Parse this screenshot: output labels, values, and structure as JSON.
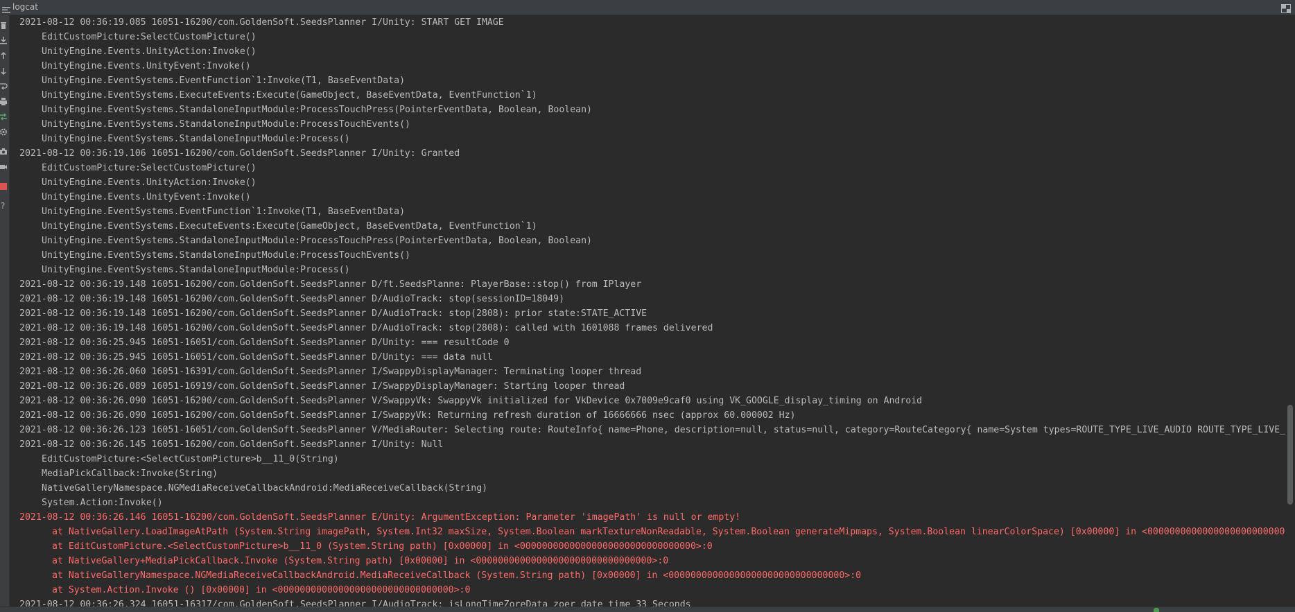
{
  "window": {
    "title": "logcat"
  },
  "icons": {
    "menu": "list-menu-icon",
    "layout": "layout-grid-icon",
    "toolbar": [
      "trash-icon",
      "scroll-to-end-icon",
      "arrow-up-icon",
      "arrow-down-icon",
      "soft-wrap-icon",
      "print-icon",
      "restart-icon",
      "settings-icon",
      "camera-icon",
      "video-icon",
      "stop-icon",
      "help-icon"
    ]
  },
  "colors": {
    "background": "#2b2b2b",
    "text": "#bbbbbb",
    "error": "#ff6b68",
    "stop_red": "#e05252",
    "restart_green": "#59a869"
  },
  "log": {
    "lines": [
      "2021-08-12 00:36:19.085 16051-16200/com.GoldenSoft.SeedsPlanner I/Unity: START GET IMAGE",
      "EditCustomPicture:SelectCustomPicture()",
      "UnityEngine.Events.UnityAction:Invoke()",
      "UnityEngine.Events.UnityEvent:Invoke()",
      "UnityEngine.EventSystems.EventFunction`1:Invoke(T1, BaseEventData)",
      "UnityEngine.EventSystems.ExecuteEvents:Execute(GameObject, BaseEventData, EventFunction`1)",
      "UnityEngine.EventSystems.StandaloneInputModule:ProcessTouchPress(PointerEventData, Boolean, Boolean)",
      "UnityEngine.EventSystems.StandaloneInputModule:ProcessTouchEvents()",
      "UnityEngine.EventSystems.StandaloneInputModule:Process()",
      "2021-08-12 00:36:19.106 16051-16200/com.GoldenSoft.SeedsPlanner I/Unity: Granted",
      "EditCustomPicture:SelectCustomPicture()",
      "UnityEngine.Events.UnityAction:Invoke()",
      "UnityEngine.Events.UnityEvent:Invoke()",
      "UnityEngine.EventSystems.EventFunction`1:Invoke(T1, BaseEventData)",
      "UnityEngine.EventSystems.ExecuteEvents:Execute(GameObject, BaseEventData, EventFunction`1)",
      "UnityEngine.EventSystems.StandaloneInputModule:ProcessTouchPress(PointerEventData, Boolean, Boolean)",
      "UnityEngine.EventSystems.StandaloneInputModule:ProcessTouchEvents()",
      "UnityEngine.EventSystems.StandaloneInputModule:Process()",
      "2021-08-12 00:36:19.148 16051-16200/com.GoldenSoft.SeedsPlanner D/ft.SeedsPlanne: PlayerBase::stop() from IPlayer",
      "2021-08-12 00:36:19.148 16051-16200/com.GoldenSoft.SeedsPlanner D/AudioTrack: stop(sessionID=18049)",
      "2021-08-12 00:36:19.148 16051-16200/com.GoldenSoft.SeedsPlanner D/AudioTrack: stop(2808): prior state:STATE_ACTIVE",
      "2021-08-12 00:36:19.148 16051-16200/com.GoldenSoft.SeedsPlanner D/AudioTrack: stop(2808): called with 1601088 frames delivered",
      "2021-08-12 00:36:25.945 16051-16051/com.GoldenSoft.SeedsPlanner D/Unity: === resultCode 0",
      "2021-08-12 00:36:25.945 16051-16051/com.GoldenSoft.SeedsPlanner D/Unity: === data null",
      "2021-08-12 00:36:26.060 16051-16391/com.GoldenSoft.SeedsPlanner I/SwappyDisplayManager: Terminating looper thread",
      "2021-08-12 00:36:26.089 16051-16919/com.GoldenSoft.SeedsPlanner I/SwappyDisplayManager: Starting looper thread",
      "2021-08-12 00:36:26.090 16051-16200/com.GoldenSoft.SeedsPlanner V/SwappyVk: SwappyVk initialized for VkDevice 0x7009e9caf0 using VK_GOOGLE_display_timing on Android",
      "2021-08-12 00:36:26.090 16051-16200/com.GoldenSoft.SeedsPlanner I/SwappyVk: Returning refresh duration of 16666666 nsec (approx 60.000002 Hz)",
      "2021-08-12 00:36:26.123 16051-16051/com.GoldenSoft.SeedsPlanner V/MediaRouter: Selecting route: RouteInfo{ name=Phone, description=null, status=null, category=RouteCategory{ name=System types=ROUTE_TYPE_LIVE_AUDIO ROUTE_TYPE_LIVE_",
      "2021-08-12 00:36:26.145 16051-16200/com.GoldenSoft.SeedsPlanner I/Unity: Null",
      "EditCustomPicture:<SelectCustomPicture>b__11_0(String)",
      "MediaPickCallback:Invoke(String)",
      "NativeGalleryNamespace.NGMediaReceiveCallbackAndroid:MediaReceiveCallback(String)",
      "System.Action:Invoke()",
      "2021-08-12 00:36:26.146 16051-16200/com.GoldenSoft.SeedsPlanner E/Unity: ArgumentException: Parameter 'imagePath' is null or empty!",
      "at NativeGallery.LoadImageAtPath (System.String imagePath, System.Int32 maxSize, System.Boolean markTextureNonReadable, System.Boolean generateMipmaps, System.Boolean linearColorSpace) [0x00000] in <0000000000000000000000000",
      "at EditCustomPicture.<SelectCustomPicture>b__11_0 (System.String path) [0x00000] in <00000000000000000000000000000000>:0",
      "at NativeGallery+MediaPickCallback.Invoke (System.String path) [0x00000] in <00000000000000000000000000000000>:0",
      "at NativeGalleryNamespace.NGMediaReceiveCallbackAndroid.MediaReceiveCallback (System.String path) [0x00000] in <00000000000000000000000000000000>:0",
      "at System.Action.Invoke () [0x00000] in <00000000000000000000000000000000>:0",
      "2021-08-12 00:36:26.324 16051-16317/com.GoldenSoft.SeedsPlanner I/AudioTrack: isLongTimeZoreData zoer date time 33 Seconds"
    ]
  }
}
